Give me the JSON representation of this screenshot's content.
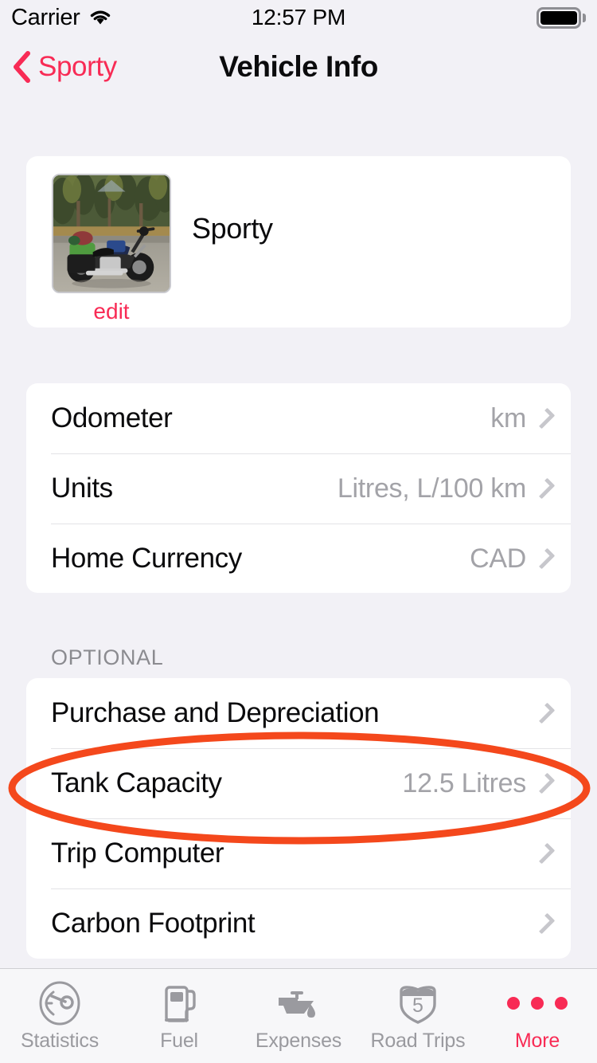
{
  "status_bar": {
    "carrier": "Carrier",
    "wifi_icon": "wifi-icon",
    "time": "12:57 PM",
    "battery_icon": "battery-full-icon"
  },
  "nav_bar": {
    "back_icon": "chevron-left-icon",
    "back_label": "Sporty",
    "title": "Vehicle Info"
  },
  "vehicle_card": {
    "photo_icon": "motorcycle-photo",
    "edit_label": "edit",
    "name": "Sporty"
  },
  "settings_rows": [
    {
      "label": "Odometer",
      "value": "km",
      "chevron": "chevron-right-icon"
    },
    {
      "label": "Units",
      "value": "Litres, L/100 km",
      "chevron": "chevron-right-icon"
    },
    {
      "label": "Home Currency",
      "value": "CAD",
      "chevron": "chevron-right-icon"
    }
  ],
  "optional_section": {
    "header": "OPTIONAL",
    "rows": [
      {
        "label": "Purchase and Depreciation",
        "value": "",
        "chevron": "chevron-right-icon"
      },
      {
        "label": "Tank Capacity",
        "value": "12.5 Litres",
        "chevron": "chevron-right-icon"
      },
      {
        "label": "Trip Computer",
        "value": "",
        "chevron": "chevron-right-icon"
      },
      {
        "label": "Carbon Footprint",
        "value": "",
        "chevron": "chevron-right-icon"
      }
    ]
  },
  "annotation": {
    "shape": "ellipse-highlight",
    "color": "#F4481C",
    "target": "Tank Capacity"
  },
  "tab_bar": {
    "items": [
      {
        "label": "Statistics",
        "icon": "speedometer-icon",
        "active": false
      },
      {
        "label": "Fuel",
        "icon": "fuel-pump-icon",
        "active": false
      },
      {
        "label": "Expenses",
        "icon": "oil-can-icon",
        "active": false
      },
      {
        "label": "Road Trips",
        "icon": "highway-shield-icon",
        "active": false
      },
      {
        "label": "More",
        "icon": "ellipsis-icon",
        "active": true
      }
    ],
    "shield_number": "5"
  },
  "colors": {
    "accent": "#F82B55",
    "background": "#F2F1F6",
    "card": "#FFFFFF",
    "secondary_text": "#A3A3A8",
    "annotation": "#F4481C"
  }
}
